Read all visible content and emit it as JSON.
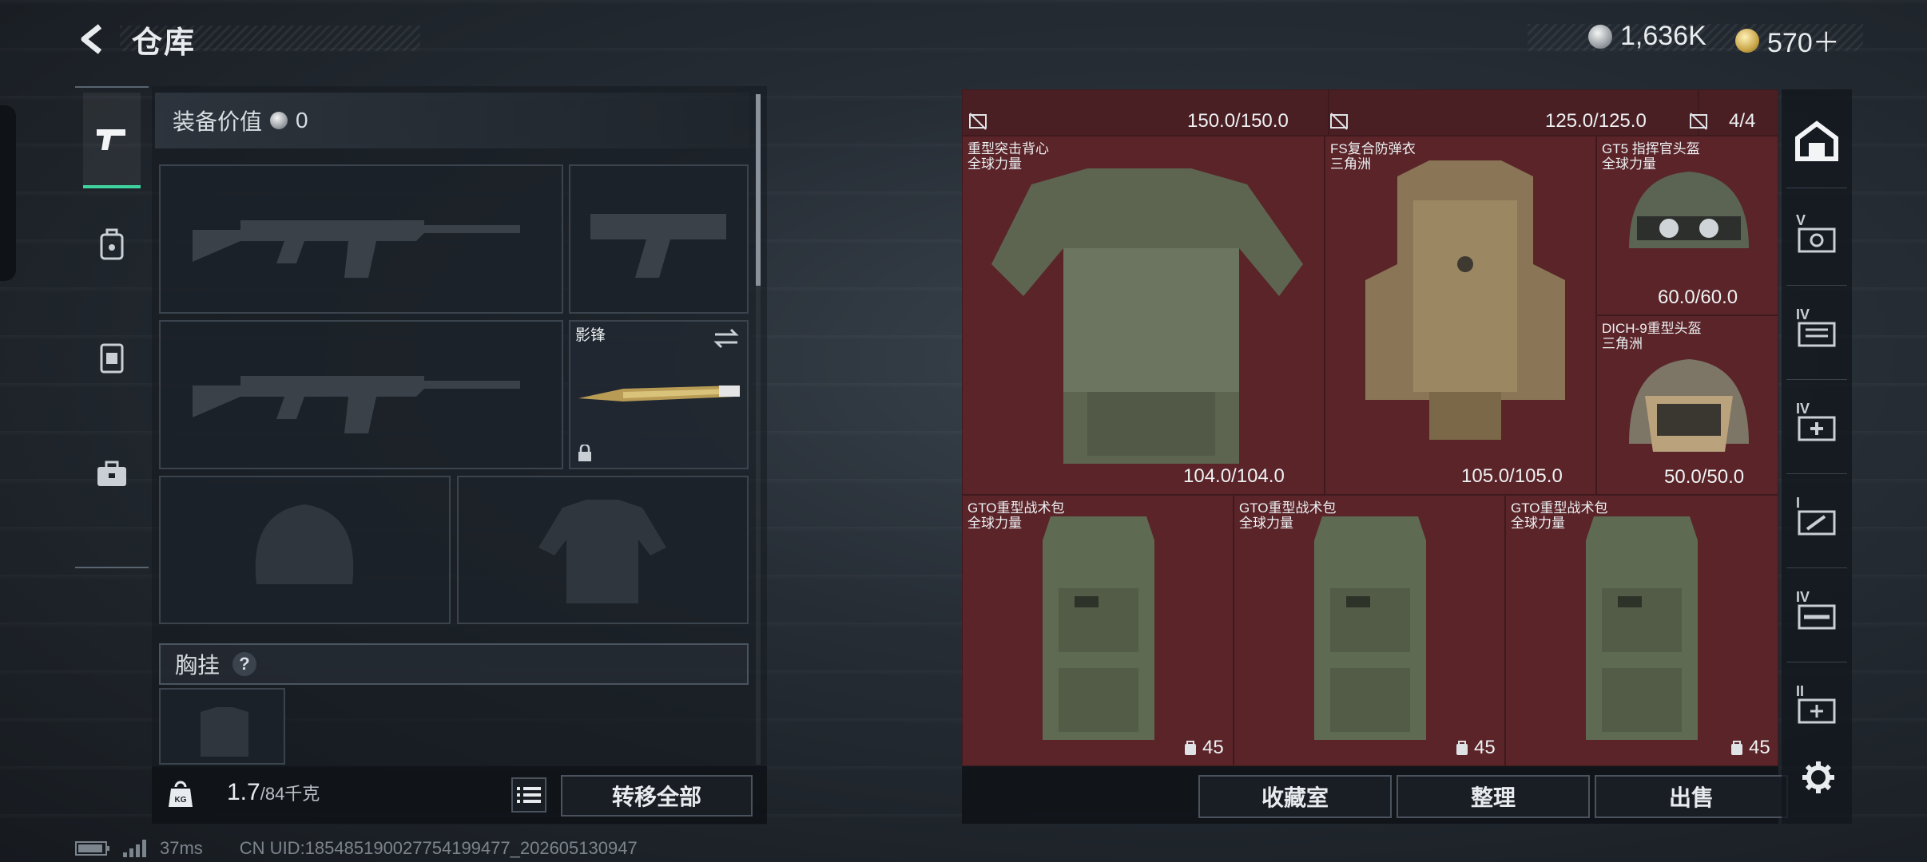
{
  "header": {
    "title": "仓库",
    "currency_silver": "1,636K",
    "currency_gold": "570＋"
  },
  "left_nav": {
    "items": [
      "weapons",
      "backpack",
      "vest",
      "toolbox"
    ],
    "active": "weapons"
  },
  "loadout": {
    "equip_value_label": "装备价值",
    "equip_value": "0",
    "melee_slot_label": "影锋",
    "chest_rig_label": "胸挂",
    "chest_rig_help": "?",
    "weight_value": "1.7",
    "weight_unit": "/84千克",
    "transfer_all_label": "转移全部"
  },
  "stash": {
    "page_indicator": "4/4",
    "top_row": [
      {
        "durability": "150.0/150.0"
      },
      {
        "durability": "125.0/125.0"
      }
    ],
    "items": [
      {
        "name": "重型突击背心",
        "source": "全球力量",
        "durability": "104.0/104.0"
      },
      {
        "name": "FS复合防弹衣",
        "source": "三角洲",
        "durability": "105.0/105.0"
      },
      {
        "name": "GT5 指挥官头盔",
        "source": "全球力量",
        "durability": "60.0/60.0"
      },
      {
        "name": "DICH-9重型头盔",
        "source": "三角洲",
        "durability": "50.0/50.0"
      },
      {
        "name": "GTO重型战术包",
        "source": "全球力量",
        "capacity": "45"
      },
      {
        "name": "GTO重型战术包",
        "source": "全球力量",
        "capacity": "45"
      },
      {
        "name": "GTO重型战术包",
        "source": "全球力量",
        "capacity": "45"
      }
    ],
    "buttons": {
      "collection": "收藏室",
      "sort": "整理",
      "sell": "出售"
    }
  },
  "right_rail": {
    "levels": [
      "V",
      "IV",
      "IV",
      "I",
      "IV",
      "II"
    ]
  },
  "status": {
    "ping": "37ms",
    "uid": "CN UID:18548519002775419947​7_202605130947"
  },
  "colors": {
    "active_accent": "#3fd3a0",
    "stash_cell": "#5a2429"
  }
}
